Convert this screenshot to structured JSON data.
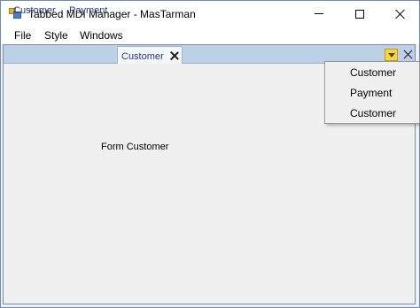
{
  "window": {
    "title": "Tabbed MDI Manager - MasTarman"
  },
  "menubar": {
    "items": [
      "File",
      "Style",
      "Windows"
    ]
  },
  "tabs": [
    {
      "label": "Customer",
      "active": false
    },
    {
      "label": "Payment",
      "active": false
    },
    {
      "label": "Customer",
      "active": true
    }
  ],
  "dropdown_menu": {
    "items": [
      "Customer",
      "Payment",
      "Customer"
    ]
  },
  "content": {
    "form_label": "Form Customer"
  },
  "icons": {
    "app": "app-icon",
    "minimize": "minimize-icon",
    "maximize": "maximize-icon",
    "close": "close-icon",
    "tab_close": "close-icon",
    "tab_list": "chevron-down-icon"
  },
  "colors": {
    "tabstrip": "#bcd0e8",
    "tab_text": "#1e3f73",
    "dropdown_button": "#f3d44f"
  }
}
